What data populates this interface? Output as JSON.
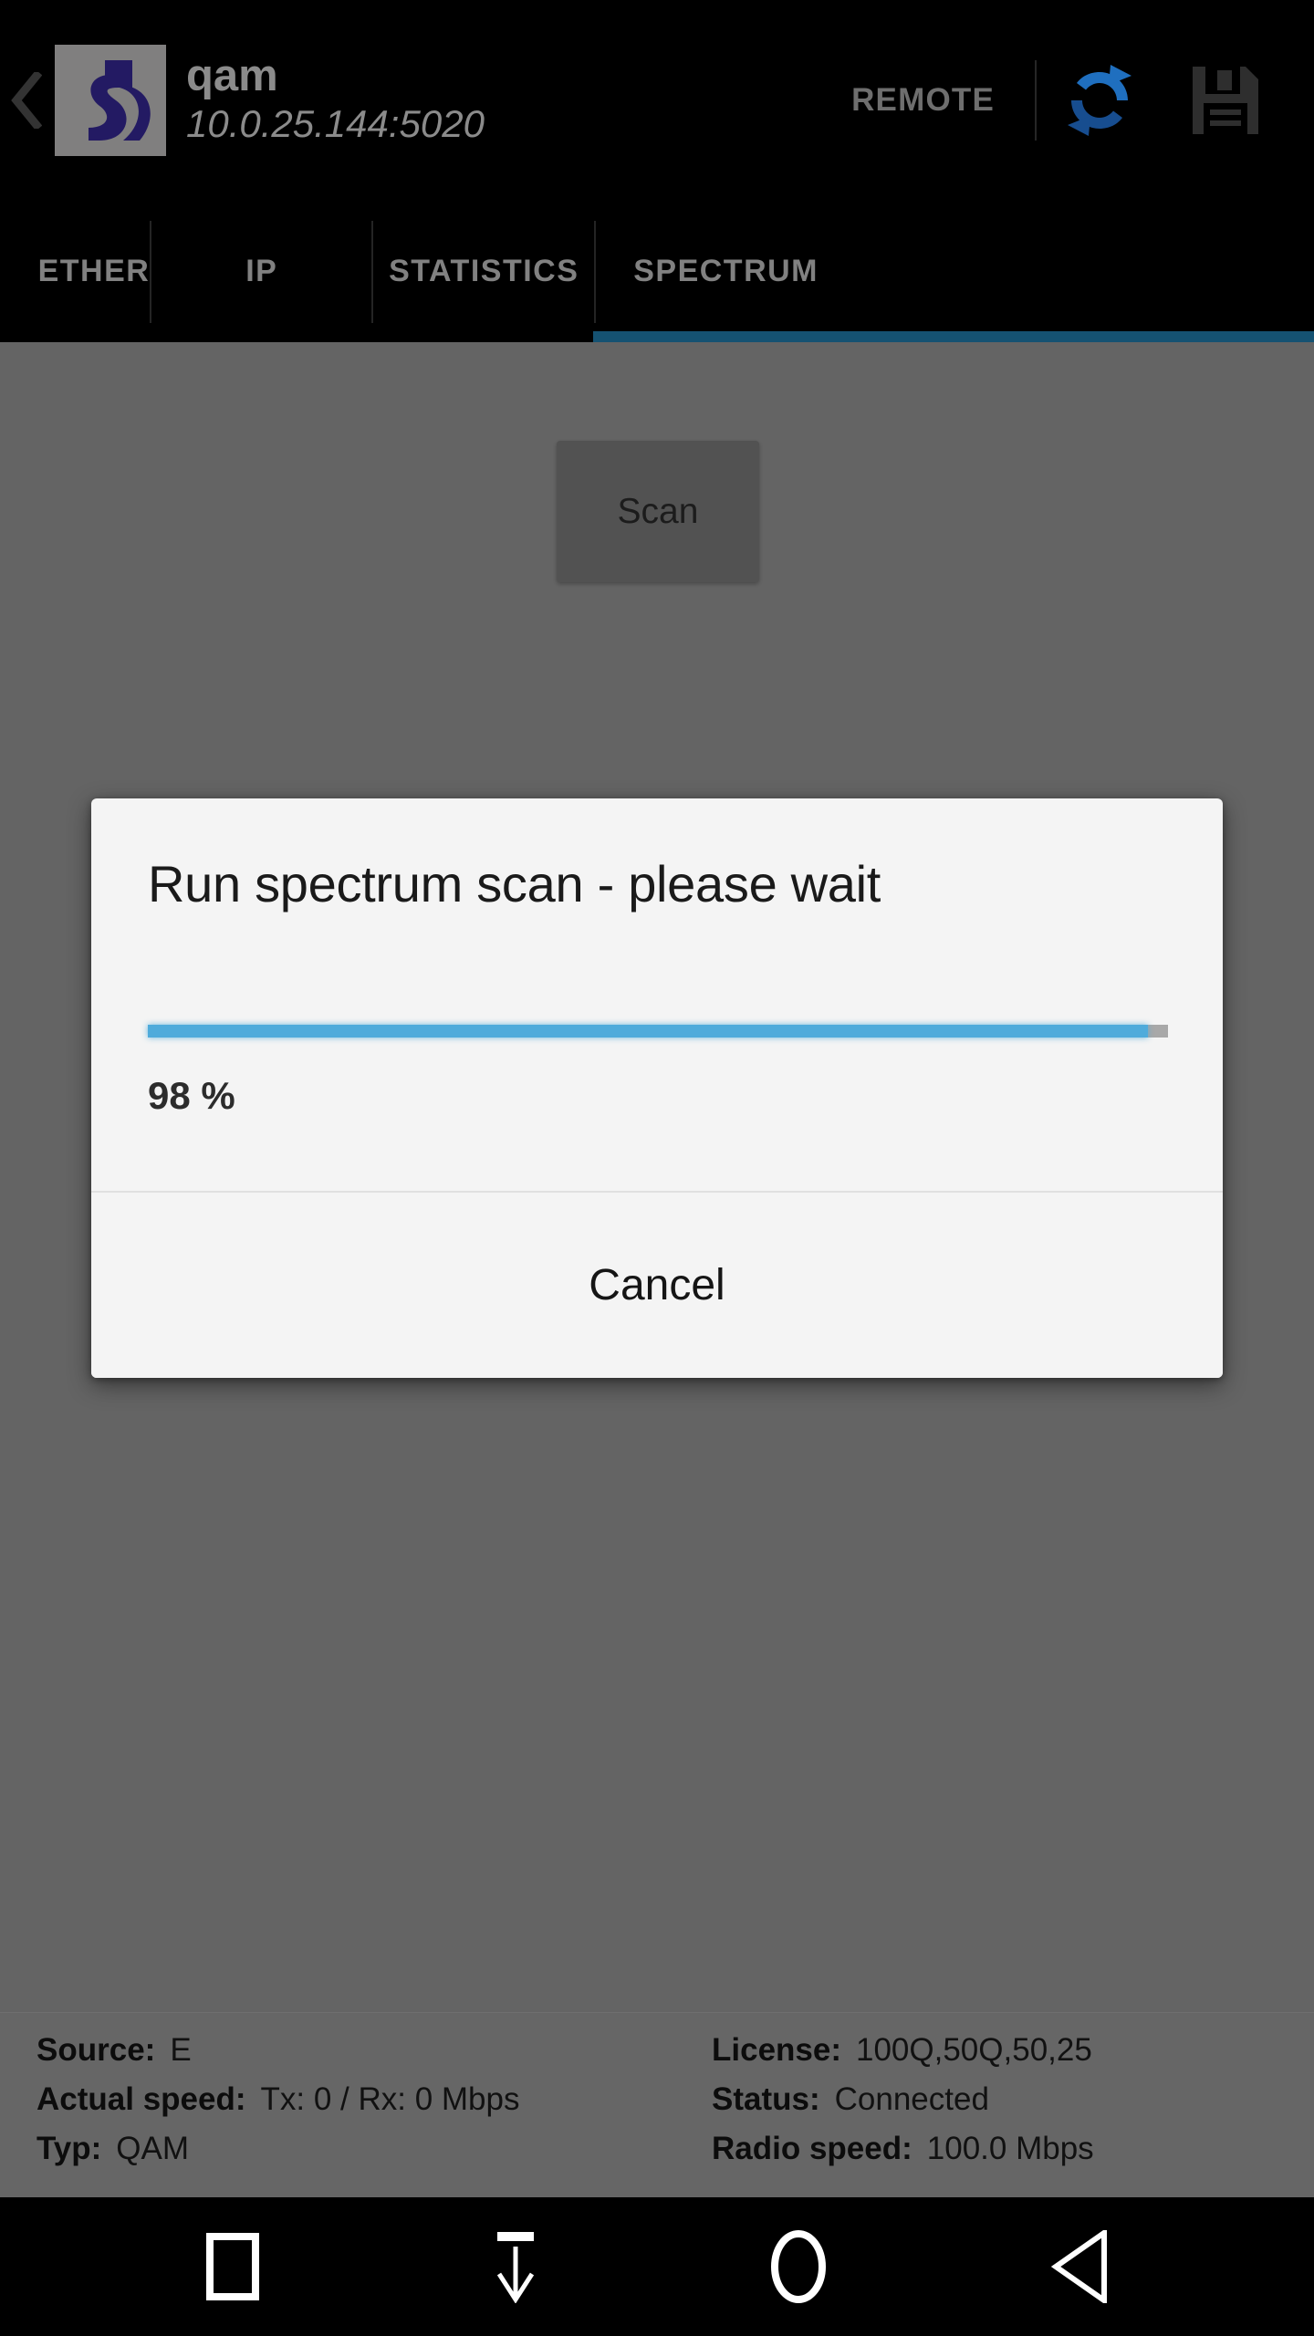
{
  "appbar": {
    "back_icon": "chevron-left-icon",
    "logo_icon": "app-logo-icon",
    "title": "qam",
    "subtitle": "10.0.25.144:5020",
    "remote_label": "REMOTE",
    "refresh_icon": "refresh-icon",
    "save_icon": "save-floppy-icon",
    "background_color": "#000000"
  },
  "tabs": {
    "items": [
      {
        "label": "ETHER",
        "active": false
      },
      {
        "label": "IP",
        "active": false
      },
      {
        "label": "STATISTICS",
        "active": false
      },
      {
        "label": "SPECTRUM",
        "active": true
      }
    ],
    "indicator_color": "#155272",
    "inactive_color": "#818181"
  },
  "content": {
    "scan_button_label": "Scan",
    "dim_color": "#646464"
  },
  "dialog": {
    "title": "Run spectrum scan - please wait",
    "progress_percent": 98,
    "progress_label": "98 %",
    "progress_fill_color": "#4fabdb",
    "progress_track_color": "#a8a8a8",
    "cancel_label": "Cancel",
    "surface_color": "#f4f4f4"
  },
  "status": {
    "rows": [
      {
        "left_key": "Source:",
        "left_value": "E",
        "right_key": "License:",
        "right_value": "100Q,50Q,50,25"
      },
      {
        "left_key": "Actual speed:",
        "left_value": "Tx: 0 / Rx: 0 Mbps",
        "right_key": "Status:",
        "right_value": "Connected"
      },
      {
        "left_key": "Typ:",
        "left_value": "QAM",
        "right_key": "Radio speed:",
        "right_value": "100.0 Mbps"
      }
    ]
  },
  "navbar": {
    "buttons": [
      {
        "icon": "recents-square-icon"
      },
      {
        "icon": "hide-keyboard-down-arrow-icon"
      },
      {
        "icon": "home-circle-icon"
      },
      {
        "icon": "back-triangle-icon"
      }
    ]
  }
}
